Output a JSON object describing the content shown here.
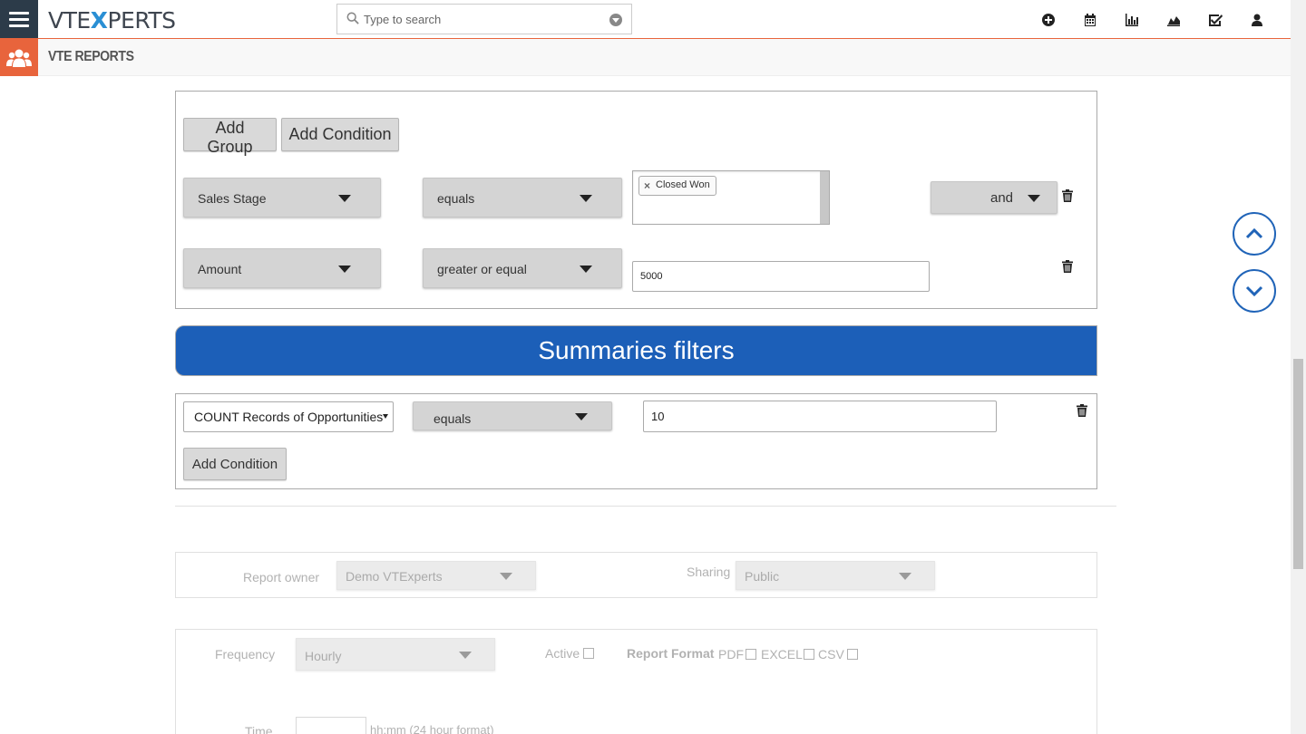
{
  "header": {
    "logo_left": "VTE",
    "logo_x": "X",
    "logo_right": "PERTS",
    "search_placeholder": "Type to search",
    "icons": [
      "plus-circle-icon",
      "calendar-icon",
      "bar-chart-icon",
      "area-chart-icon",
      "checkbox-icon",
      "user-icon"
    ]
  },
  "module": {
    "title": "VTE REPORTS",
    "icon": "users-group-icon"
  },
  "conditions": {
    "add_group_label": "Add Group",
    "add_condition_label": "Add Condition",
    "rows": [
      {
        "field": "Sales Stage",
        "operator": "equals",
        "tag": "Closed Won",
        "join": "and"
      },
      {
        "field": "Amount",
        "operator": "greater or equal",
        "value": "5000"
      }
    ]
  },
  "summaries": {
    "title": "Summaries filters",
    "field": "COUNT Records of Opportunities",
    "operator": "equals",
    "value": "10",
    "add_condition_label": "Add Condition"
  },
  "sharing": {
    "owner_label": "Report owner",
    "owner_value": "Demo VTExperts",
    "sharing_label": "Sharing",
    "sharing_value": "Public"
  },
  "schedule": {
    "frequency_label": "Frequency",
    "frequency_value": "Hourly",
    "active_label": "Active",
    "format_label": "Report Format",
    "formats": [
      "PDF",
      "EXCEL",
      "CSV"
    ],
    "time_label": "Time",
    "time_hint": "hh:mm (24 hour format)"
  },
  "colors": {
    "accent": "#e8643c",
    "primary": "#1c5fb8",
    "topbar_dark": "#2c3b49"
  }
}
